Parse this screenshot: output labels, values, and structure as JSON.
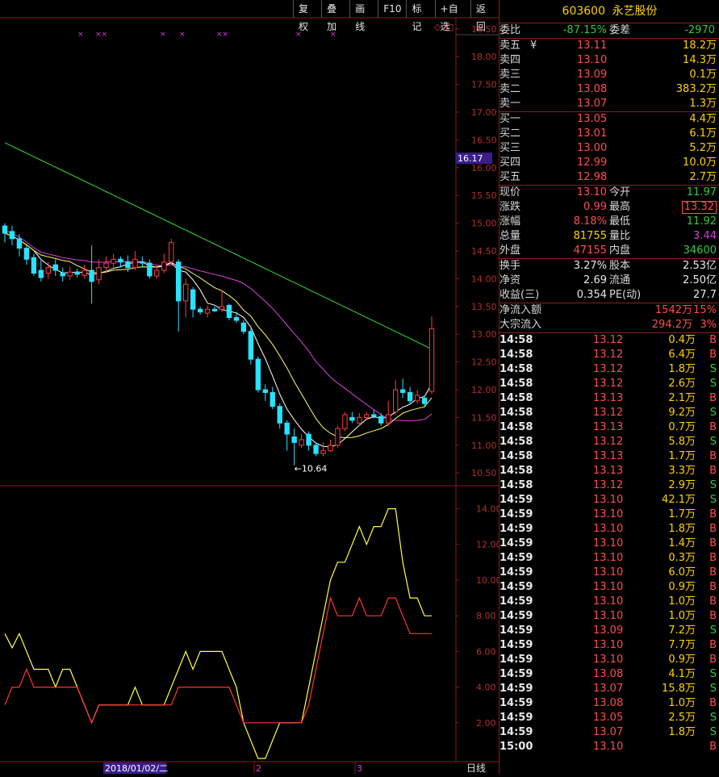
{
  "toolbar": [
    "复权",
    "叠加",
    "画线",
    "F10",
    "标记",
    "+自选",
    "返回"
  ],
  "stock": {
    "code": "603600",
    "name": "永艺股份"
  },
  "weibi": {
    "l1": "委比",
    "v1": "-87.15%",
    "l2": "委差",
    "v2": "-2970"
  },
  "sell": [
    {
      "label": "卖五",
      "price": "13.11",
      "vol": "18.2万"
    },
    {
      "label": "卖四",
      "price": "13.10",
      "vol": "14.3万"
    },
    {
      "label": "卖三",
      "price": "13.09",
      "vol": "0.1万"
    },
    {
      "label": "卖二",
      "price": "13.08",
      "vol": "383.2万"
    },
    {
      "label": "卖一",
      "price": "13.07",
      "vol": "1.3万"
    }
  ],
  "yen_symbol": "¥",
  "buy": [
    {
      "label": "买一",
      "price": "13.05",
      "vol": "4.4万"
    },
    {
      "label": "买二",
      "price": "13.01",
      "vol": "6.1万"
    },
    {
      "label": "买三",
      "price": "13.00",
      "vol": "5.2万"
    },
    {
      "label": "买四",
      "price": "12.99",
      "vol": "10.0万"
    },
    {
      "label": "买五",
      "price": "12.98",
      "vol": "2.7万"
    }
  ],
  "quote": [
    {
      "l1": "现价",
      "v1": "13.10",
      "c1": "r",
      "l2": "今开",
      "v2": "11.97",
      "c2": "g"
    },
    {
      "l1": "涨跌",
      "v1": "0.99",
      "c1": "r",
      "l2": "最高",
      "v2": "13.32",
      "c2": "r"
    },
    {
      "l1": "涨幅",
      "v1": "8.18%",
      "c1": "r",
      "l2": "最低",
      "v2": "11.92",
      "c2": "g"
    },
    {
      "l1": "总量",
      "v1": "81755",
      "c1": "y",
      "l2": "量比",
      "v2": "3.44",
      "c2": "m"
    },
    {
      "l1": "外盘",
      "v1": "47155",
      "c1": "r",
      "l2": "内盘",
      "v2": "34600",
      "c2": "g"
    }
  ],
  "fund": [
    {
      "l1": "换手",
      "v1": "3.27%",
      "l2": "股本",
      "v2": "2.53亿"
    },
    {
      "l1": "净资",
      "v1": "2.69",
      "l2": "流通",
      "v2": "2.50亿"
    },
    {
      "l1": "收益(三)",
      "v1": "0.354",
      "l2": "PE(动)",
      "v2": "27.7"
    }
  ],
  "flow": [
    {
      "label": "净流入额",
      "value": "1542万",
      "pct": "15%"
    },
    {
      "label": "大宗流入",
      "value": "294.2万",
      "pct": "3%"
    }
  ],
  "ticks": [
    [
      "14:58",
      "13.12",
      "0.4万",
      "B"
    ],
    [
      "14:58",
      "13.12",
      "6.4万",
      "B"
    ],
    [
      "14:58",
      "13.12",
      "1.8万",
      "S"
    ],
    [
      "14:58",
      "13.12",
      "2.6万",
      "S"
    ],
    [
      "14:58",
      "13.13",
      "2.1万",
      "B"
    ],
    [
      "14:58",
      "13.12",
      "9.2万",
      "S"
    ],
    [
      "14:58",
      "13.13",
      "0.7万",
      "B"
    ],
    [
      "14:58",
      "13.12",
      "5.8万",
      "S"
    ],
    [
      "14:58",
      "13.13",
      "1.7万",
      "B"
    ],
    [
      "14:58",
      "13.13",
      "3.3万",
      "B"
    ],
    [
      "14:58",
      "13.12",
      "2.9万",
      "S"
    ],
    [
      "14:59",
      "13.10",
      "42.1万",
      "S"
    ],
    [
      "14:59",
      "13.10",
      "1.7万",
      "B"
    ],
    [
      "14:59",
      "13.10",
      "1.8万",
      "B"
    ],
    [
      "14:59",
      "13.10",
      "1.4万",
      "B"
    ],
    [
      "14:59",
      "13.10",
      "0.3万",
      "B"
    ],
    [
      "14:59",
      "13.10",
      "6.0万",
      "B"
    ],
    [
      "14:59",
      "13.10",
      "0.9万",
      "B"
    ],
    [
      "14:59",
      "13.10",
      "1.0万",
      "B"
    ],
    [
      "14:59",
      "13.10",
      "1.0万",
      "B"
    ],
    [
      "14:59",
      "13.09",
      "7.2万",
      "S"
    ],
    [
      "14:59",
      "13.10",
      "7.7万",
      "B"
    ],
    [
      "14:59",
      "13.10",
      "0.9万",
      "B"
    ],
    [
      "14:59",
      "13.08",
      "4.1万",
      "S"
    ],
    [
      "14:59",
      "13.07",
      "15.8万",
      "S"
    ],
    [
      "14:59",
      "13.08",
      "1.0万",
      "B"
    ],
    [
      "14:59",
      "13.05",
      "2.5万",
      "S"
    ],
    [
      "14:59",
      "13.07",
      "1.8万",
      "S"
    ],
    [
      "15:00",
      "13.10",
      "",
      "B"
    ]
  ],
  "price_axis": [
    "18.50",
    "18.00",
    "17.50",
    "17.00",
    "16.50",
    "16.00",
    "15.50",
    "15.00",
    "14.50",
    "14.00",
    "13.50",
    "13.00",
    "12.50",
    "12.00",
    "11.50",
    "11.00",
    "10.50"
  ],
  "price_marker": "16.17",
  "low_label": "10.64",
  "ind_axis": [
    "14.00",
    "12.00",
    "10.00",
    "8.00",
    "6.00",
    "4.00",
    "2.00"
  ],
  "date_labels": {
    "d1": "2018/01/02/二",
    "d2": "2",
    "d3": "3"
  },
  "period": "日线",
  "colors": {
    "up": "#ff3b3b",
    "down": "#27e3ff",
    "ma_white": "#ffffff",
    "ma_yellow": "#ffff66",
    "ma_magenta": "#e040e0",
    "ma_green": "#33dd33",
    "grid": "#8a1c1c"
  },
  "chart_data": {
    "type": "candlestick",
    "candles": [
      [
        14.95,
        14.82,
        15.0,
        14.65
      ],
      [
        14.85,
        14.72,
        14.95,
        14.6
      ],
      [
        14.72,
        14.55,
        14.8,
        14.4
      ],
      [
        14.55,
        14.35,
        14.6,
        14.25
      ],
      [
        14.38,
        14.1,
        14.45,
        14.05
      ],
      [
        14.15,
        14.02,
        14.35,
        13.95
      ],
      [
        14.1,
        14.2,
        14.3,
        14.0
      ],
      [
        14.25,
        14.15,
        14.35,
        14.05
      ],
      [
        14.1,
        14.05,
        14.2,
        13.95
      ],
      [
        14.05,
        14.12,
        14.22,
        13.98
      ],
      [
        14.12,
        14.08,
        14.18,
        14.02
      ],
      [
        14.06,
        14.15,
        14.25,
        14.0
      ],
      [
        14.15,
        13.95,
        14.6,
        13.55
      ],
      [
        13.98,
        14.2,
        14.35,
        13.9
      ],
      [
        14.2,
        14.28,
        14.4,
        14.1
      ],
      [
        14.28,
        14.35,
        14.45,
        14.15
      ],
      [
        14.35,
        14.3,
        14.4,
        14.2
      ],
      [
        14.3,
        14.2,
        14.42,
        14.12
      ],
      [
        14.2,
        14.35,
        14.5,
        14.15
      ],
      [
        14.3,
        14.28,
        14.4,
        14.2
      ],
      [
        14.28,
        14.05,
        14.35,
        14.0
      ],
      [
        14.05,
        14.15,
        14.25,
        14.0
      ],
      [
        14.15,
        14.3,
        14.45,
        14.1
      ],
      [
        14.3,
        14.65,
        14.72,
        14.25
      ],
      [
        14.3,
        13.6,
        14.35,
        13.05
      ],
      [
        13.6,
        13.9,
        14.0,
        13.3
      ],
      [
        13.8,
        13.45,
        13.85,
        13.3
      ],
      [
        13.45,
        13.4,
        13.5,
        13.35
      ],
      [
        13.38,
        13.45,
        13.52,
        13.3
      ],
      [
        13.45,
        13.42,
        13.5,
        13.4
      ],
      [
        13.45,
        13.5,
        13.8,
        13.4
      ],
      [
        13.52,
        13.3,
        13.55,
        13.25
      ],
      [
        13.3,
        13.25,
        13.4,
        13.2
      ],
      [
        13.2,
        13.05,
        13.25,
        13.0
      ],
      [
        13.05,
        12.55,
        13.1,
        12.45
      ],
      [
        12.55,
        12.0,
        12.6,
        11.95
      ],
      [
        12.0,
        11.95,
        12.1,
        11.8
      ],
      [
        11.95,
        11.7,
        12.05,
        11.65
      ],
      [
        11.7,
        11.4,
        11.75,
        11.3
      ],
      [
        11.4,
        11.2,
        11.45,
        10.9
      ],
      [
        11.15,
        11.05,
        11.3,
        10.64
      ],
      [
        11.0,
        11.1,
        11.2,
        10.95
      ],
      [
        11.2,
        11.0,
        11.25,
        10.9
      ],
      [
        11.0,
        10.85,
        11.05,
        10.8
      ],
      [
        10.85,
        10.9,
        11.05,
        10.8
      ],
      [
        10.9,
        11.0,
        11.1,
        10.88
      ],
      [
        11.0,
        11.3,
        11.35,
        10.95
      ],
      [
        11.3,
        11.55,
        11.6,
        11.25
      ],
      [
        11.5,
        11.45,
        11.6,
        11.4
      ],
      [
        11.4,
        11.5,
        11.58,
        11.35
      ],
      [
        11.5,
        11.55,
        11.6,
        11.45
      ],
      [
        11.55,
        11.52,
        11.65,
        11.48
      ],
      [
        11.52,
        11.4,
        11.58,
        11.35
      ],
      [
        11.4,
        11.55,
        11.8,
        11.35
      ],
      [
        11.6,
        12.0,
        12.18,
        11.55
      ],
      [
        12.0,
        11.95,
        12.2,
        11.85
      ],
      [
        11.95,
        11.8,
        12.05,
        11.75
      ],
      [
        11.8,
        11.9,
        12.0,
        11.75
      ],
      [
        11.85,
        11.75,
        11.9,
        11.7
      ],
      [
        11.97,
        13.1,
        13.32,
        11.92
      ]
    ],
    "ylim": [
      10.3,
      18.7
    ],
    "ind_ylim": [
      0,
      15.2
    ],
    "ind_yellow": [
      7.0,
      6.2,
      7.0,
      6.0,
      5.0,
      5.0,
      5.0,
      4.0,
      5.0,
      5.0,
      4.0,
      3.0,
      2.0,
      3.0,
      3.0,
      3.0,
      3.0,
      3.0,
      4.0,
      3.0,
      3.0,
      3.0,
      3.0,
      4.0,
      5.0,
      6.0,
      5.0,
      6.0,
      6.0,
      6.0,
      6.0,
      5.0,
      4.0,
      2.0,
      1.0,
      0.0,
      0.0,
      1.0,
      2.0,
      2.0,
      2.0,
      2.0,
      4.0,
      6.0,
      8.0,
      10.0,
      11.0,
      11.0,
      12.0,
      13.0,
      12.0,
      13.0,
      13.0,
      14.0,
      14.0,
      11.0,
      9.0,
      9.0,
      8.0,
      8.0
    ],
    "ind_red": [
      3.0,
      4.0,
      4.0,
      5.0,
      4.0,
      4.0,
      4.0,
      4.0,
      4.0,
      4.0,
      4.0,
      3.0,
      2.0,
      3.0,
      3.0,
      3.0,
      3.0,
      3.0,
      3.0,
      3.0,
      3.0,
      3.0,
      3.0,
      3.0,
      4.0,
      4.0,
      4.0,
      4.0,
      4.0,
      4.0,
      4.0,
      4.0,
      3.0,
      2.0,
      2.0,
      2.0,
      2.0,
      2.0,
      2.0,
      2.0,
      2.0,
      2.0,
      3.0,
      5.0,
      7.0,
      9.0,
      8.0,
      8.0,
      8.0,
      9.0,
      8.0,
      8.0,
      8.0,
      9.0,
      9.0,
      8.0,
      7.0,
      7.0,
      7.0,
      7.0
    ],
    "marks": [
      "×",
      "××",
      "×",
      "×",
      "××",
      "×",
      "×"
    ]
  }
}
